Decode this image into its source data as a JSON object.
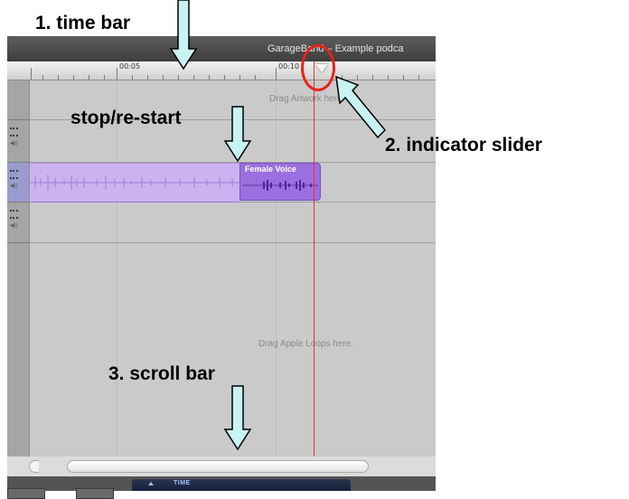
{
  "window": {
    "title": "GarageBand – Example podca"
  },
  "ruler": {
    "labels": [
      "00:05",
      "00:10"
    ]
  },
  "tracks": {
    "artwork_hint": "Drag Artwork here.",
    "loops_hint": "Drag Apple Loops here.",
    "region_name": "Female Voice",
    "region_color": "#9c6fe0",
    "selected_track_color": "#9a9ad0"
  },
  "lcd": {
    "label": "TIME"
  },
  "playhead": {
    "color": "#e8362b"
  },
  "annotations": {
    "time_bar": "1. time bar",
    "indicator_slider": "2. indicator slider",
    "stop_restart": "stop/re-start",
    "scroll_bar": "3. scroll bar",
    "highlight_color": "#e8231a",
    "arrow_fill": "#c9f2f2"
  }
}
